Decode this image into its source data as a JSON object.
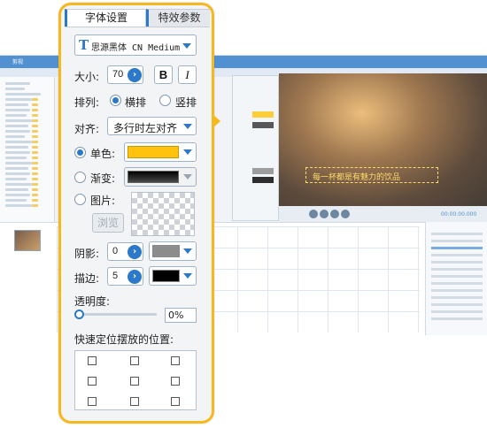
{
  "background_app": {
    "title": "剪视",
    "video_caption": "每一杯都是有魅力的饮品",
    "timecode": "00:00:00.000"
  },
  "tabs": {
    "active": "字体设置",
    "inactive": "特效参数"
  },
  "font": {
    "icon": "T",
    "name": "思源黑体 CN Medium"
  },
  "size": {
    "label": "大小:",
    "value": "70",
    "bold_label": "B",
    "italic_label": "I"
  },
  "layout": {
    "label": "排列:",
    "options": [
      "横排",
      "竖排"
    ],
    "selected": "横排"
  },
  "align": {
    "label": "对齐:",
    "value": "多行时左对齐"
  },
  "fill": {
    "solid_label": "单色:",
    "gradient_label": "渐变:",
    "image_label": "图片:",
    "browse_label": "浏览",
    "selected": "单色",
    "solid_color": "#ffc20e"
  },
  "shadow": {
    "label": "阴影:",
    "value": "0",
    "color": "#8c8c8c"
  },
  "stroke": {
    "label": "描边:",
    "value": "5",
    "color": "#000000"
  },
  "opacity": {
    "label": "透明度:",
    "value": "0%"
  },
  "quick_position": {
    "label": "快速定位摆放的位置:"
  },
  "colors": {
    "accent": "#2b79c8",
    "highlight_border": "#f6b81c"
  }
}
